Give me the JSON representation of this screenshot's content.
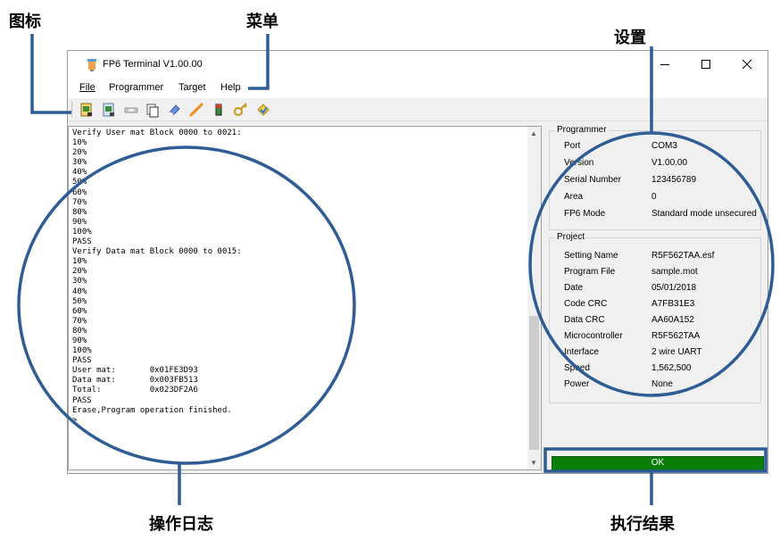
{
  "annotations": {
    "icons": "图标",
    "menu": "菜单",
    "settings": "设置",
    "log": "操作日志",
    "result": "执行结果"
  },
  "window": {
    "title": "FP6 Terminal V1.00.00",
    "minimize": "–",
    "maximize": "☐",
    "close": "✕"
  },
  "menu": {
    "file": "File",
    "programmer": "Programmer",
    "target": "Target",
    "help": "Help"
  },
  "toolbar": {
    "icons": [
      "open-settings-icon",
      "save-settings-icon",
      "connect-icon",
      "copy-icon",
      "erase-icon",
      "program-icon",
      "battery-icon",
      "key-icon",
      "verify-icon"
    ]
  },
  "log": {
    "lines": [
      "Verify User mat Block 0000 to 0021:",
      "10%",
      "20%",
      "30%",
      "40%",
      "50%",
      "60%",
      "70%",
      "80%",
      "90%",
      "100%",
      "PASS",
      "Verify Data mat Block 0000 to 0015:",
      "10%",
      "20%",
      "30%",
      "40%",
      "50%",
      "60%",
      "70%",
      "80%",
      "90%",
      "100%",
      "PASS",
      "User mat:       0x01FE3D93",
      "Data mat:       0x003FB513",
      "Total:          0x023DF2A6",
      "PASS",
      "Erase,Program operation finished.",
      ">"
    ]
  },
  "programmer": {
    "group_label": "Programmer",
    "rows": [
      {
        "key": "Port",
        "value": "COM3"
      },
      {
        "key": "Version",
        "value": "V1.00.00"
      },
      {
        "key": "Serial Number",
        "value": "123456789"
      },
      {
        "key": "Area",
        "value": "0"
      },
      {
        "key": "FP6 Mode",
        "value": "Standard mode unsecured"
      }
    ]
  },
  "project": {
    "group_label": "Project",
    "rows": [
      {
        "key": "Setting Name",
        "value": "R5F562TAA.esf"
      },
      {
        "key": "Program File",
        "value": "sample.mot"
      },
      {
        "key": "Date",
        "value": "05/01/2018"
      },
      {
        "key": "Code CRC",
        "value": "A7FB31E3"
      },
      {
        "key": "Data CRC",
        "value": "AA60A152"
      },
      {
        "key": "Microcontroller",
        "value": "R5F562TAA"
      },
      {
        "key": "Interface",
        "value": "2 wire UART"
      },
      {
        "key": "Speed",
        "value": "1,562,500"
      },
      {
        "key": "Power",
        "value": "None"
      }
    ]
  },
  "result": {
    "label": "OK",
    "color": "#0a7e07"
  },
  "colors": {
    "annotation_blue": "#2e5c94"
  }
}
